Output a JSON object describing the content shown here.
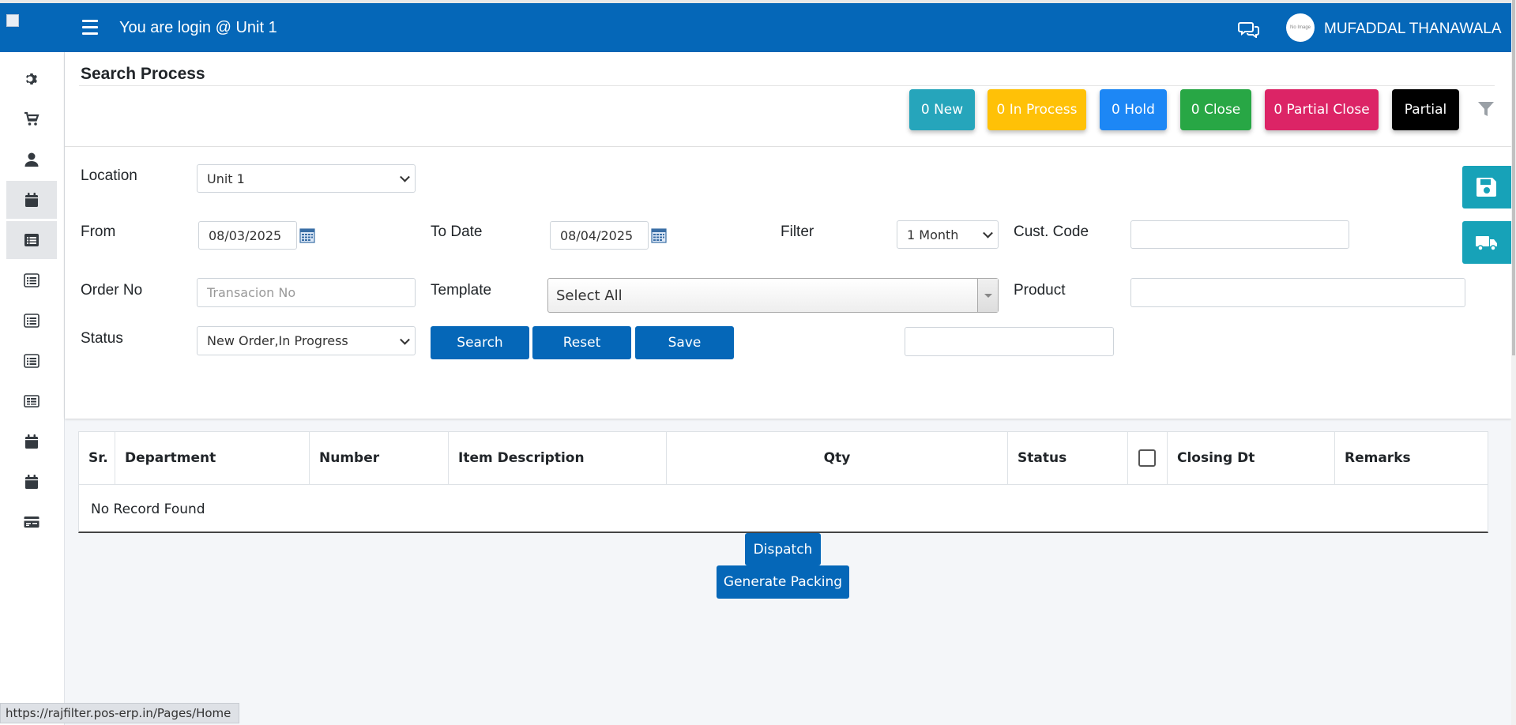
{
  "header": {
    "login_text": "You are login @ Unit 1",
    "user_name": "MUFADDAL THANAWALA",
    "avatar_text": "No Image"
  },
  "sidebar": {
    "items": [
      {
        "icon": "gear-icon"
      },
      {
        "icon": "cart-icon"
      },
      {
        "icon": "user-icon"
      },
      {
        "icon": "calendar-icon",
        "active": true
      },
      {
        "icon": "list-icon",
        "active": true
      },
      {
        "icon": "list-icon"
      },
      {
        "icon": "list-icon"
      },
      {
        "icon": "list-icon"
      },
      {
        "icon": "list-alt-icon"
      },
      {
        "icon": "calendar-icon"
      },
      {
        "icon": "calendar-icon"
      },
      {
        "icon": "card-icon"
      }
    ]
  },
  "page": {
    "title": "Search Process"
  },
  "stats": {
    "new": "0 New",
    "in_process": "0 In Process",
    "hold": "0 Hold",
    "close": "0 Close",
    "partial_close": "0 Partial Close",
    "partial": "Partial",
    "colors": {
      "new": "#26a5bb",
      "in_process": "#ffc107",
      "hold": "#1d87f5",
      "close": "#28a745",
      "partial_close": "#dc2466",
      "partial": "#000000"
    }
  },
  "form": {
    "location_label": "Location",
    "location_value": "Unit 1",
    "from_label": "From",
    "from_value": "08/03/2025",
    "to_label": "To Date",
    "to_value": "08/04/2025",
    "filter_label": "Filter",
    "filter_value": "1 Month",
    "cust_code_label": "Cust. Code",
    "cust_code_value": "",
    "order_no_label": "Order No",
    "order_no_placeholder": "Transacion No",
    "template_label": "Template",
    "template_value": "Select All",
    "product_label": "Product",
    "product_value": "",
    "status_label": "Status",
    "status_value": "New Order,In Progress",
    "search_button": "Search",
    "reset_button": "Reset",
    "save_button": "Save",
    "extra_field_value": ""
  },
  "table": {
    "columns": [
      "Sr.",
      "Department",
      "Number",
      "Item Description",
      "Qty",
      "Status",
      "",
      "Closing Dt",
      "Remarks"
    ],
    "empty_text": "No Record Found"
  },
  "actions": {
    "dispatch": "Dispatch",
    "generate_packing": "Generate Packing"
  },
  "statusbar": {
    "url": "https://rajfilter.pos-erp.in/Pages/Home"
  }
}
